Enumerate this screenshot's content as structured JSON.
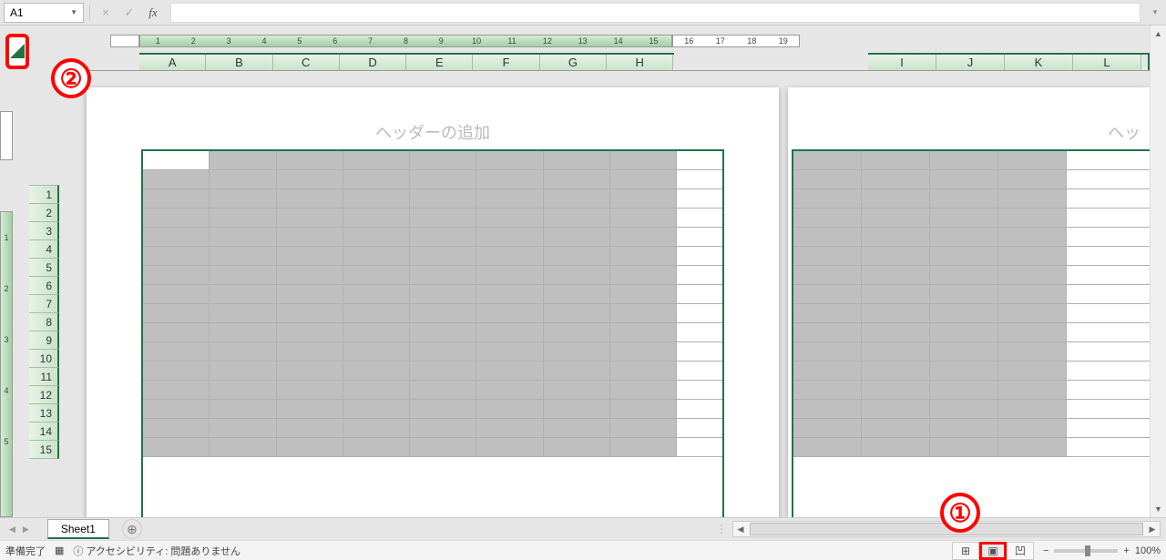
{
  "formula_bar": {
    "name_box": "A1",
    "cancel": "×",
    "confirm": "✓",
    "fx": "fx",
    "value": ""
  },
  "annotations": {
    "callout1": "①",
    "callout2": "②"
  },
  "ruler_h": [
    "1",
    "2",
    "3",
    "4",
    "5",
    "6",
    "7",
    "8",
    "9",
    "10",
    "11",
    "12",
    "13",
    "14",
    "15",
    "16",
    "17",
    "18",
    "19"
  ],
  "ruler_v": [
    "1",
    "2",
    "3",
    "4",
    "5"
  ],
  "columns_page1": [
    "A",
    "B",
    "C",
    "D",
    "E",
    "F",
    "G",
    "H"
  ],
  "columns_page2": [
    "I",
    "J",
    "K",
    "L"
  ],
  "rows": [
    "1",
    "2",
    "3",
    "4",
    "5",
    "6",
    "7",
    "8",
    "9",
    "10",
    "11",
    "12",
    "13",
    "14",
    "15"
  ],
  "page": {
    "header_placeholder": "ヘッダーの追加",
    "header_truncated": "ヘッ"
  },
  "tabs": {
    "sheet1": "Sheet1"
  },
  "status": {
    "ready": "準備完了",
    "accessibility": "アクセシビリティ: 問題ありません",
    "zoom_pct": "100%",
    "minus": "−",
    "plus": "+"
  }
}
